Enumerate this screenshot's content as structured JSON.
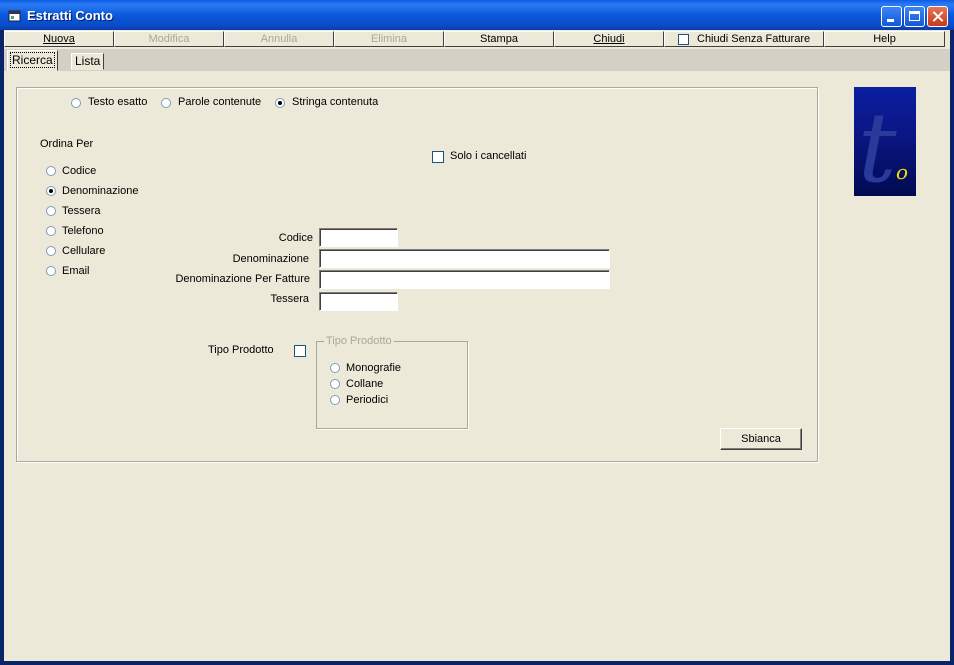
{
  "window": {
    "title": "Estratti Conto"
  },
  "toolbar": {
    "buttons": [
      {
        "label": "Nuova",
        "enabled": true
      },
      {
        "label": "Modifica",
        "enabled": false
      },
      {
        "label": "Annulla",
        "enabled": false
      },
      {
        "label": "Elimina",
        "enabled": false
      },
      {
        "label": "Stampa",
        "enabled": true
      },
      {
        "label": "Chiudi",
        "enabled": true
      }
    ],
    "chiudi_senza_fatturare": {
      "label": "Chiudi Senza Fatturare",
      "checked": false
    },
    "help_label": "Help"
  },
  "tabs": [
    {
      "label": "Ricerca",
      "active": true
    },
    {
      "label": "Lista",
      "active": false
    }
  ],
  "search_mode": {
    "options": [
      "Testo esatto",
      "Parole contenute",
      "Stringa contenuta"
    ],
    "selected": "Stringa contenuta"
  },
  "ordina_per": {
    "label": "Ordina Per",
    "options": [
      "Codice",
      "Denominazione",
      "Tessera",
      "Telefono",
      "Cellulare",
      "Email"
    ],
    "selected": "Denominazione"
  },
  "solo_cancellati": {
    "label": "Solo i cancellati",
    "checked": false
  },
  "fields": [
    {
      "label": "Codice",
      "value": ""
    },
    {
      "label": "Denominazione",
      "value": ""
    },
    {
      "label": "Denominazione Per Fatture",
      "value": ""
    },
    {
      "label": "Tessera",
      "value": ""
    }
  ],
  "tipo_prodotto": {
    "label": "Tipo Prodotto",
    "checked": false,
    "group_title": "Tipo Prodotto",
    "options": [
      "Monografie",
      "Collane",
      "Periodici"
    ],
    "selected": null
  },
  "sbianca_label": "Sbianca",
  "logo": {
    "glyph": "t",
    "sub": "o"
  },
  "colors": {
    "titlebar": "#0a5ce4",
    "face": "#ece9d8",
    "logo_bg": "#0a1a8a",
    "logo_sub": "#f0e000"
  }
}
